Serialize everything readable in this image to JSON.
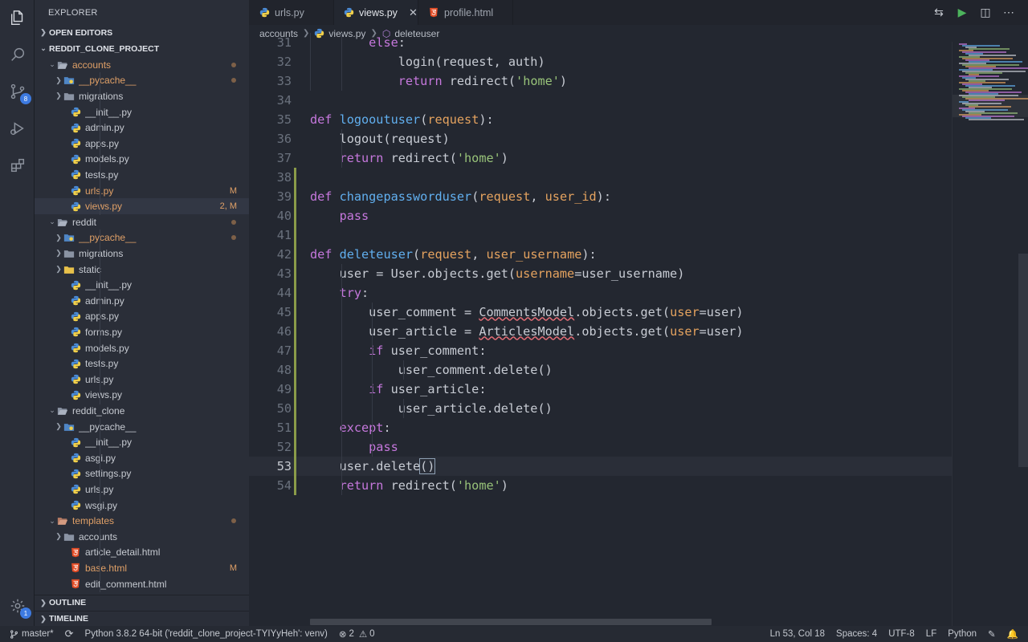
{
  "activity_bar": {
    "scm_badge": "8",
    "settings_badge": "1"
  },
  "sidebar": {
    "title": "EXPLORER",
    "open_editors": "OPEN EDITORS",
    "project": "REDDIT_CLONE_PROJECT",
    "outline": "OUTLINE",
    "timeline": "TIMELINE",
    "tree": [
      {
        "name": "accounts",
        "kind": "folder-open",
        "status": "dot",
        "mod": true
      },
      {
        "name": "__pycache__",
        "kind": "pycache",
        "status": "dot",
        "mod": true
      },
      {
        "name": "migrations",
        "kind": "folder",
        "status": "",
        "mod": false
      },
      {
        "name": "__init__.py",
        "kind": "py",
        "status": "",
        "mod": false
      },
      {
        "name": "admin.py",
        "kind": "py",
        "status": "",
        "mod": false
      },
      {
        "name": "apps.py",
        "kind": "py",
        "status": "",
        "mod": false
      },
      {
        "name": "models.py",
        "kind": "py",
        "status": "",
        "mod": false
      },
      {
        "name": "tests.py",
        "kind": "py",
        "status": "",
        "mod": false
      },
      {
        "name": "urls.py",
        "kind": "py",
        "status": "M",
        "mod": true
      },
      {
        "name": "views.py",
        "kind": "py",
        "status": "2, M",
        "mod": true
      },
      {
        "name": "reddit",
        "kind": "folder-open",
        "status": "dot",
        "mod": false
      },
      {
        "name": "__pycache__",
        "kind": "pycache",
        "status": "dot",
        "mod": true
      },
      {
        "name": "migrations",
        "kind": "folder",
        "status": "",
        "mod": false
      },
      {
        "name": "static",
        "kind": "folder-static",
        "status": "",
        "mod": false
      },
      {
        "name": "__init__.py",
        "kind": "py",
        "status": "",
        "mod": false
      },
      {
        "name": "admin.py",
        "kind": "py",
        "status": "",
        "mod": false
      },
      {
        "name": "apps.py",
        "kind": "py",
        "status": "",
        "mod": false
      },
      {
        "name": "forms.py",
        "kind": "py",
        "status": "",
        "mod": false
      },
      {
        "name": "models.py",
        "kind": "py",
        "status": "",
        "mod": false
      },
      {
        "name": "tests.py",
        "kind": "py",
        "status": "",
        "mod": false
      },
      {
        "name": "urls.py",
        "kind": "py",
        "status": "",
        "mod": false
      },
      {
        "name": "views.py",
        "kind": "py",
        "status": "",
        "mod": false
      },
      {
        "name": "reddit_clone",
        "kind": "folder-open",
        "status": "",
        "mod": false
      },
      {
        "name": "__pycache__",
        "kind": "pycache",
        "status": "",
        "mod": false
      },
      {
        "name": "__init__.py",
        "kind": "py",
        "status": "",
        "mod": false
      },
      {
        "name": "asgi.py",
        "kind": "py",
        "status": "",
        "mod": false
      },
      {
        "name": "settings.py",
        "kind": "py",
        "status": "",
        "mod": false
      },
      {
        "name": "urls.py",
        "kind": "py",
        "status": "",
        "mod": false
      },
      {
        "name": "wsgi.py",
        "kind": "py",
        "status": "",
        "mod": false
      },
      {
        "name": "templates",
        "kind": "folder-open-tpl",
        "status": "dot",
        "mod": true
      },
      {
        "name": "accounts",
        "kind": "folder",
        "status": "",
        "mod": false
      },
      {
        "name": "article_detail.html",
        "kind": "html",
        "status": "",
        "mod": false
      },
      {
        "name": "base.html",
        "kind": "html",
        "status": "M",
        "mod": true
      },
      {
        "name": "edit_comment.html",
        "kind": "html",
        "status": "",
        "mod": false
      }
    ]
  },
  "tabs": [
    {
      "label": "urls.py",
      "kind": "py",
      "active": false
    },
    {
      "label": "views.py",
      "kind": "py",
      "active": true
    },
    {
      "label": "profile.html",
      "kind": "html",
      "active": false
    }
  ],
  "breadcrumb": {
    "folder": "accounts",
    "file": "views.py",
    "symbol": "deleteuser"
  },
  "code": {
    "current_line": 53,
    "lines": [
      {
        "n": "31",
        "t": [
          [
            "        ",
            ""
          ],
          [
            "else",
            ":kw"
          ],
          [
            ":",
            ""
          ]
        ]
      },
      {
        "n": "32",
        "t": [
          [
            "            login(request, auth)",
            ""
          ]
        ]
      },
      {
        "n": "33",
        "t": [
          [
            "            ",
            ""
          ],
          [
            "return",
            "kw"
          ],
          [
            " redirect(",
            ""
          ],
          [
            "'home'",
            "sg"
          ],
          [
            ")",
            ""
          ]
        ]
      },
      {
        "n": "34",
        "t": []
      },
      {
        "n": "35",
        "t": [
          [
            "def",
            "kw"
          ],
          [
            " ",
            ""
          ],
          [
            "logooutuser",
            "fn"
          ],
          [
            "(",
            ""
          ],
          [
            "request",
            "pr"
          ],
          [
            "):",
            ""
          ]
        ]
      },
      {
        "n": "36",
        "t": [
          [
            "    logout(request)",
            ""
          ]
        ]
      },
      {
        "n": "37",
        "t": [
          [
            "    ",
            ""
          ],
          [
            "return",
            "kw"
          ],
          [
            " redirect(",
            ""
          ],
          [
            "'home'",
            "sg"
          ],
          [
            ")",
            ""
          ]
        ]
      },
      {
        "n": "38",
        "t": []
      },
      {
        "n": "39",
        "t": [
          [
            "def",
            "kw"
          ],
          [
            " ",
            ""
          ],
          [
            "changepassworduser",
            "fn"
          ],
          [
            "(",
            ""
          ],
          [
            "request",
            "pr"
          ],
          [
            ", ",
            ""
          ],
          [
            "user_id",
            "pr"
          ],
          [
            "):",
            ""
          ]
        ]
      },
      {
        "n": "40",
        "t": [
          [
            "    ",
            ""
          ],
          [
            "pass",
            "kw"
          ]
        ]
      },
      {
        "n": "41",
        "t": []
      },
      {
        "n": "42",
        "t": [
          [
            "def",
            "kw"
          ],
          [
            " ",
            ""
          ],
          [
            "deleteuser",
            "fn"
          ],
          [
            "(",
            ""
          ],
          [
            "request",
            "pr"
          ],
          [
            ", ",
            ""
          ],
          [
            "user_username",
            "pr"
          ],
          [
            "):",
            ""
          ]
        ]
      },
      {
        "n": "43",
        "t": [
          [
            "    user = User.objects.get(",
            ""
          ],
          [
            "username",
            "pr"
          ],
          [
            "=user_username)",
            ""
          ]
        ]
      },
      {
        "n": "44",
        "t": [
          [
            "    ",
            ""
          ],
          [
            "try",
            "kw"
          ],
          [
            ":",
            ""
          ]
        ]
      },
      {
        "n": "45",
        "t": [
          [
            "        user_comment = ",
            ""
          ],
          [
            "CommentsModel",
            "sq"
          ],
          [
            ".objects.get(",
            ""
          ],
          [
            "user",
            "pr"
          ],
          [
            "=user)",
            ""
          ]
        ]
      },
      {
        "n": "46",
        "t": [
          [
            "        user_article = ",
            ""
          ],
          [
            "ArticlesModel",
            "sq"
          ],
          [
            ".objects.get(",
            ""
          ],
          [
            "user",
            "pr"
          ],
          [
            "=user)",
            ""
          ]
        ]
      },
      {
        "n": "47",
        "t": [
          [
            "        ",
            ""
          ],
          [
            "if",
            "kw"
          ],
          [
            " user_comment:",
            ""
          ]
        ]
      },
      {
        "n": "48",
        "t": [
          [
            "            user_comment.delete()",
            ""
          ]
        ]
      },
      {
        "n": "49",
        "t": [
          [
            "        ",
            ""
          ],
          [
            "if",
            "kw"
          ],
          [
            " user_article:",
            ""
          ]
        ]
      },
      {
        "n": "50",
        "t": [
          [
            "            user_article.delete()",
            ""
          ]
        ]
      },
      {
        "n": "51",
        "t": [
          [
            "    ",
            ""
          ],
          [
            "except",
            "kw"
          ],
          [
            ":",
            ""
          ]
        ]
      },
      {
        "n": "52",
        "t": [
          [
            "        ",
            ""
          ],
          [
            "pass",
            "kw"
          ]
        ]
      },
      {
        "n": "53",
        "t": [
          [
            "    user.delete",
            ""
          ],
          [
            "()",
            "bm"
          ]
        ]
      },
      {
        "n": "54",
        "t": [
          [
            "    ",
            ""
          ],
          [
            "return",
            "kw"
          ],
          [
            " redirect(",
            ""
          ],
          [
            "'home'",
            "sg"
          ],
          [
            ")",
            ""
          ]
        ]
      }
    ]
  },
  "status": {
    "branch": "master*",
    "interpreter": "Python 3.8.2 64-bit ('reddit_clone_project-TYIYyHeh': venv)",
    "errors": "2",
    "warnings": "0",
    "position": "Ln 53, Col 18",
    "spaces": "Spaces: 4",
    "encoding": "UTF-8",
    "eol": "LF",
    "language": "Python"
  },
  "colors": {
    "keyword": "#c678dd",
    "function": "#61afef",
    "parameter": "#e5a35f",
    "string": "#98c379",
    "modified": "#e0a067"
  }
}
